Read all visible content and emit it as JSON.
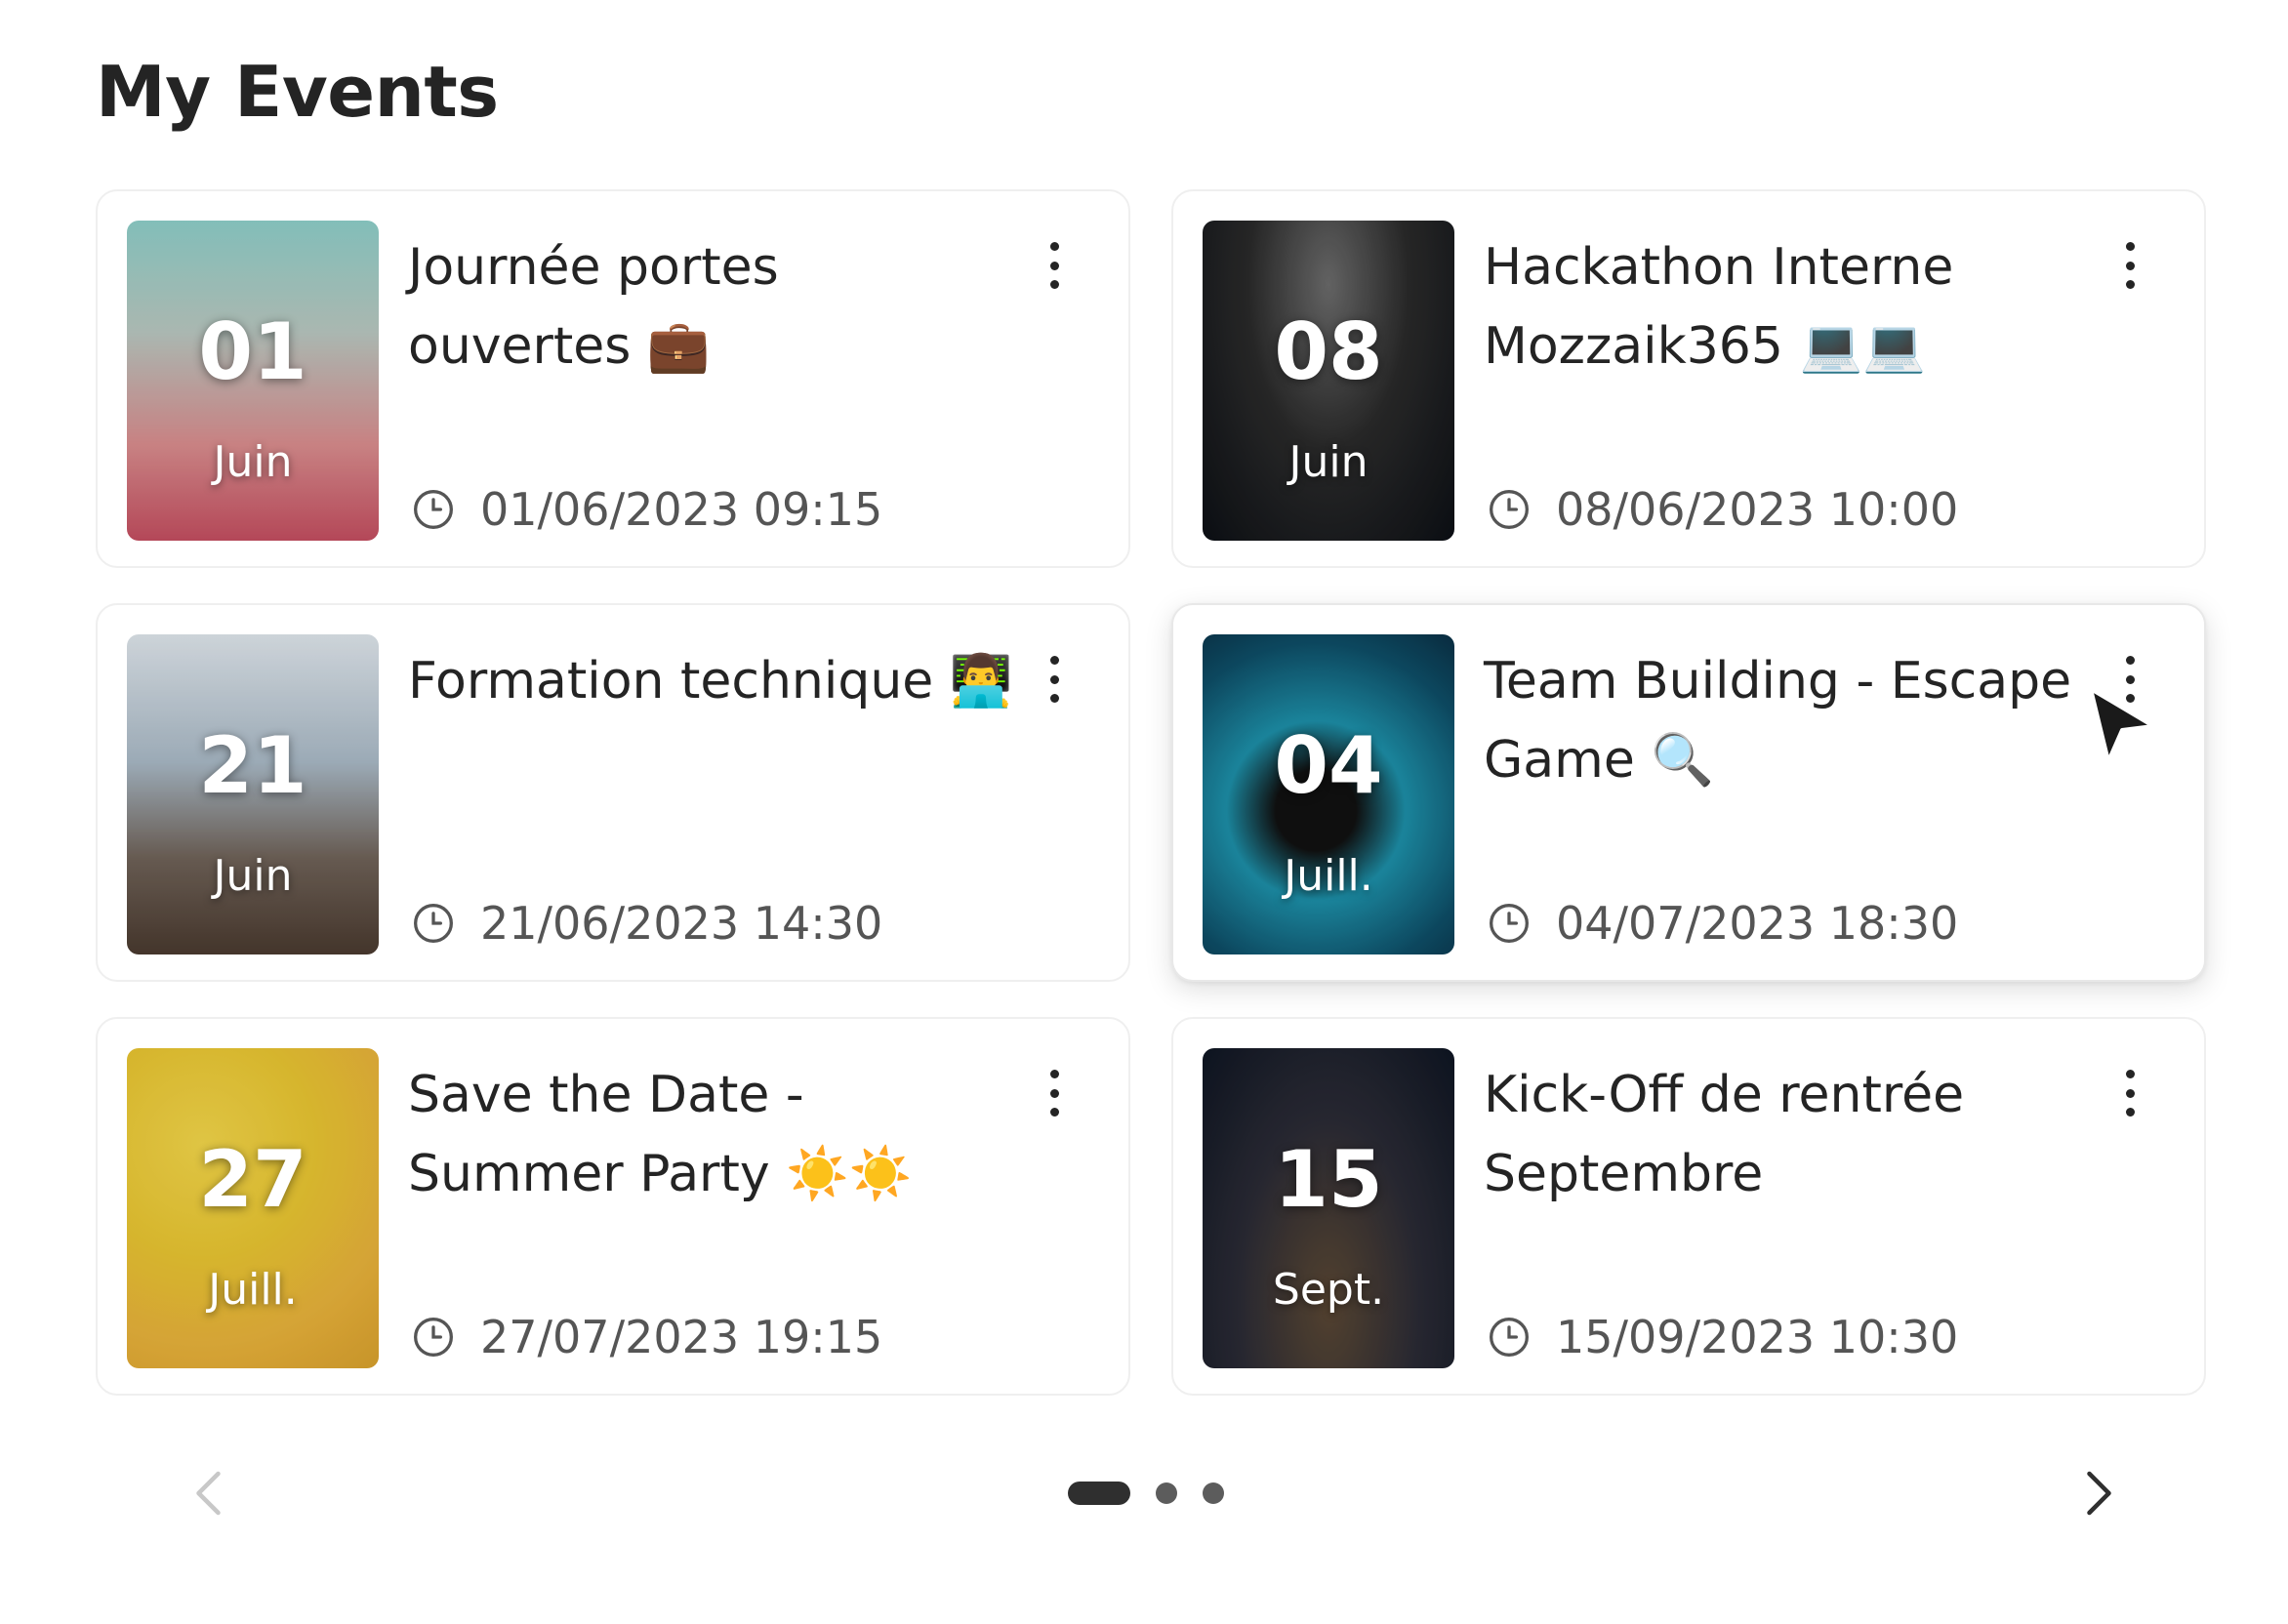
{
  "page": {
    "title": "My Events"
  },
  "events": [
    {
      "day": "01",
      "month": "Juin",
      "title": "Journée portes ouvertes 💼",
      "datetime": "01/06/2023 09:15"
    },
    {
      "day": "08",
      "month": "Juin",
      "title": "Hackathon Interne Mozzaik365 💻💻",
      "datetime": "08/06/2023 10:00"
    },
    {
      "day": "21",
      "month": "Juin",
      "title": "Formation technique 👨‍💻",
      "datetime": "21/06/2023 14:30"
    },
    {
      "day": "04",
      "month": "Juill.",
      "title": "Team Building  - Escape Game 🔍",
      "datetime": "04/07/2023 18:30"
    },
    {
      "day": "27",
      "month": "Juill.",
      "title": "Save the Date - Summer Party ☀️☀️",
      "datetime": "27/07/2023 19:15"
    },
    {
      "day": "15",
      "month": "Sept.",
      "title": "Kick-Off de rentrée Septembre",
      "datetime": "15/09/2023 10:30"
    }
  ],
  "pager": {
    "pages": 3,
    "current": 1
  }
}
